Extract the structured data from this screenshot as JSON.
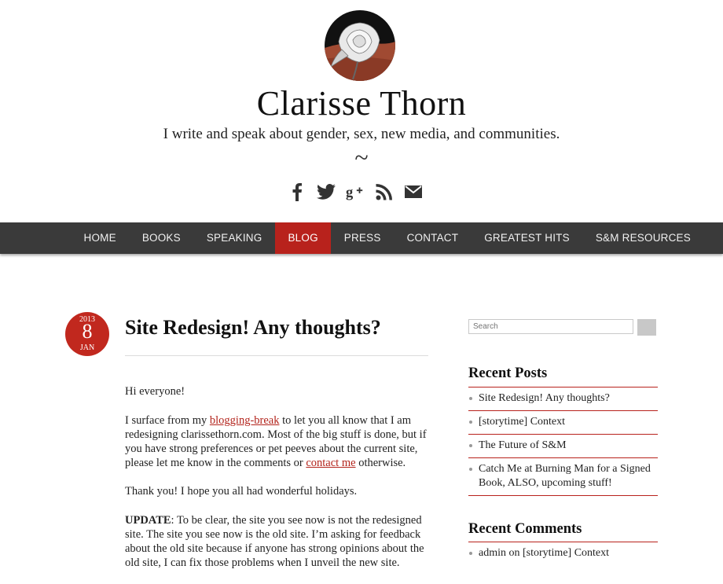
{
  "header": {
    "site_title": "Clarisse Thorn",
    "tagline": "I write and speak about gender, sex, new media, and communities.",
    "divider": "~",
    "social_icons": [
      "facebook-icon",
      "twitter-icon",
      "google-plus-icon",
      "rss-icon",
      "email-icon"
    ]
  },
  "nav": {
    "items": [
      "HOME",
      "BOOKS",
      "SPEAKING",
      "BLOG",
      "PRESS",
      "CONTACT",
      "GREATEST HITS",
      "S&M RESOURCES"
    ],
    "active": "BLOG"
  },
  "post": {
    "date": {
      "year": "2013",
      "day": "8",
      "month": "JAN"
    },
    "title": "Site Redesign! Any thoughts?",
    "p1": "Hi everyone!",
    "p2_a": "I surface from my ",
    "p2_link1": "blogging-break",
    "p2_b": " to let you all know that I am redesigning clarissethorn.com. Most of the big stuff is done, but if you have strong preferences or pet peeves about the current site, please let me know in the comments or ",
    "p2_link2": "contact me",
    "p2_c": " otherwise.",
    "p3": "Thank you! I hope you all had wonderful holidays.",
    "p4_label": "UPDATE",
    "p4_text": ": To be clear, the site you see now is not the redesigned site. The site you see now is the old site. I’m asking for feedback about the old site because if anyone has strong opinions about the old site, I can fix those problems when I unveil the new site."
  },
  "sidebar": {
    "search_placeholder": "Search",
    "recent_posts_title": "Recent Posts",
    "recent_posts": [
      "Site Redesign! Any thoughts?",
      "[storytime] Context",
      "The Future of S&M",
      "Catch Me at Burning Man for a Signed Book, ALSO, upcoming stuff!"
    ],
    "recent_comments_title": "Recent Comments",
    "recent_comments": [
      "admin on [storytime] Context"
    ]
  },
  "colors": {
    "accent": "#b8221c",
    "nav_bg": "#3a3a3a"
  }
}
